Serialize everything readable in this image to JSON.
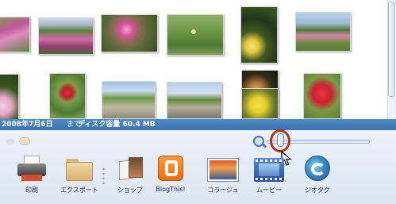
{
  "status": {
    "date": "2008年7月6日",
    "until_label": "まで",
    "capacity": "ディスク容量 60.4 MB"
  },
  "photos": [
    {
      "name": "cosmos-field-1"
    },
    {
      "name": "cosmos-field-2"
    },
    {
      "name": "pink-cosmos-closeup"
    },
    {
      "name": "green-grass"
    },
    {
      "name": "yellow-flowers-dark"
    },
    {
      "name": "cosmos-field-hill"
    },
    {
      "name": "pink-flower-partial"
    },
    {
      "name": "red-rose-bush"
    },
    {
      "name": "park-road"
    },
    {
      "name": "park-pathway"
    },
    {
      "name": "angel-trumpet-flowers"
    },
    {
      "name": "yellow-rose"
    },
    {
      "name": "red-rose"
    }
  ],
  "zoom": {
    "level_fraction": 0.1
  },
  "toolbar": {
    "print_label": "印刷",
    "export_label": "エクスポート",
    "slideshow_label": "ショップ",
    "blog_label": "BlogThis!",
    "collage_label": "コラージュ",
    "movie_label": "ムービー",
    "geotag_label": "ジオタグ"
  },
  "colors": {
    "status_bar": "#3f7cb9",
    "highlight_ring": "#b8321c"
  }
}
